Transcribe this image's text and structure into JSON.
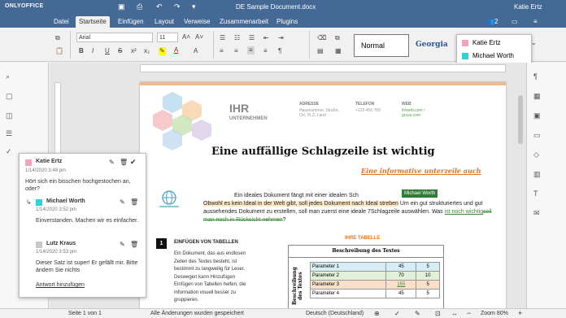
{
  "app": {
    "logo": "ONLYOFFICE",
    "doc_title": "DE Sample Document.docx",
    "user": "Katie Ertz",
    "user_count": "2"
  },
  "tabs": [
    "Datei",
    "Startseite",
    "Einfügen",
    "Layout",
    "Verweise",
    "Zusammenarbeit",
    "Plugins"
  ],
  "toolbar": {
    "font": "Arial",
    "size": "11",
    "style_normal": "Normal",
    "style_georgia": "Georgia"
  },
  "users_popup": [
    {
      "name": "Katie Ertz",
      "color": "#f3a3c0"
    },
    {
      "name": "Michael Worth",
      "color": "#2ed3d3"
    }
  ],
  "doc": {
    "logo_line1": "IHR",
    "logo_line2": "UNTERNEHMEN",
    "col1_head": "ADRESSE",
    "col1_body": "Hausnummer, Straße, Ort, PLZ, Land",
    "col2_head": "TELEFON",
    "col2_body": "+123 456 789",
    "col3_head": "WEB",
    "col3_body": "ihrweb.com / gruss.com",
    "headline": "Eine auffällige Schlagzeile ist wichtig",
    "subheadline": "Eine informative unterzeile auch",
    "para1a": "Ein ideales Dokument fängt mit einer idealen Sch",
    "para1b": "Obwohl es kein Ideal in der Welt gibt, soll jedes Dokument nach Ideal streben",
    "para1c": "Um ein gut strukturiertes und gut aussehendes Dokument zu erstellen, soll man zuerst eine ideale 7Schlagzeile auswählen. Was",
    "para1d": "ist noch wichtig",
    "para1e": "soll man noch in Rücksicht nehmen",
    "para1f": "?",
    "cursor_label": "Michael Worth",
    "section_num": "1",
    "section_title": "EINFÜGEN VON TABELLEN",
    "section_body": "Ein Dokument, das aus endlosen Zeilen des Textes besteht, ist bestimmt zu langweilig für Leser. Deswegen kann Hinzufügen Einfügen von Tabellen helfen, die Information visuell besser zu gruppieren.",
    "table_title": "IHRE TABELLE",
    "table_head": "Beschreibung des Textes",
    "table_side": "Beschreibung des Textes",
    "rows": [
      [
        "Parameter 1",
        "45",
        "5"
      ],
      [
        "Parameter 2",
        "70",
        "10"
      ],
      [
        "Parameter 3",
        "155",
        "5"
      ],
      [
        "Parameter 4",
        "45",
        "5"
      ]
    ]
  },
  "comments": [
    {
      "author": "Katie Ertz",
      "date": "1/14/2020 3:48 pm",
      "text": "Hört sich ein bisschen hochgestochen an, oder?",
      "color": "#f3a3c0"
    },
    {
      "author": "Michael Worth",
      "date": "1/14/2020 3:52 pm",
      "text": "Einverstanden. Machen wir es einfacher.",
      "color": "#2ed3d3"
    },
    {
      "author": "Lutz Kraus",
      "date": "1/14/2020 3:53 pm",
      "text": "Dieser Satz ist super! Er gefällt mir. Bitte ändern Sie nichts",
      "color": "#c8c8c8"
    }
  ],
  "add_reply": "Antwort hinzufügen",
  "status": {
    "page": "Seite 1 von 1",
    "saved": "Alle Änderungen wurden gespeichert",
    "lang": "Deutsch (Deutschland)",
    "zoom": "Zoom 80%"
  }
}
